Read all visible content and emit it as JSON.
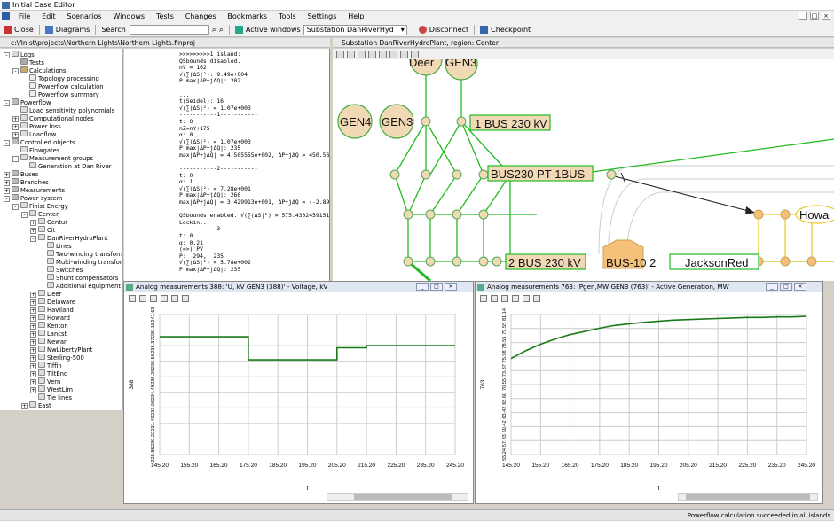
{
  "app": {
    "title": "Initial Case Editor"
  },
  "menu": [
    "File",
    "Edit",
    "Scenarios",
    "Windows",
    "Tests",
    "Changes",
    "Bookmarks",
    "Tools",
    "Settings",
    "Help"
  ],
  "toolbar": {
    "close": "Close",
    "diagrams": "Diagrams",
    "search": "Search",
    "active_windows": "Active windows",
    "substation": "Substation DanRiverHyd",
    "disconnect": "Disconnect",
    "checkpoint": "Checkpoint"
  },
  "project": {
    "path": "c:\\finist\\projects\\Northern Lights\\Northern Lights.finproj"
  },
  "tree": [
    {
      "l": "Logs",
      "d": 0,
      "pm": "-",
      "c": "#d8d8d8"
    },
    {
      "l": "Tests",
      "d": 1,
      "pm": "",
      "c": "#aaa"
    },
    {
      "l": "Calculations",
      "d": 1,
      "pm": "-",
      "c": "#c9a86a"
    },
    {
      "l": "Topology processing",
      "d": 2,
      "pm": "",
      "c": "#eee"
    },
    {
      "l": "Powerflow calculation",
      "d": 2,
      "pm": "",
      "c": "#eee"
    },
    {
      "l": "Powerflow summary",
      "d": 2,
      "pm": "",
      "c": "#eee"
    },
    {
      "l": "Powerflow",
      "d": 0,
      "pm": "-",
      "c": "#bbb"
    },
    {
      "l": "Load sensitivity polynomials",
      "d": 1,
      "pm": "",
      "c": "#ddd"
    },
    {
      "l": "Computational nodes",
      "d": 1,
      "pm": "+",
      "c": "#ddd"
    },
    {
      "l": "Power loss",
      "d": 1,
      "pm": "+",
      "c": "#ddd"
    },
    {
      "l": "Loadflow",
      "d": 1,
      "pm": "+",
      "c": "#ddd"
    },
    {
      "l": "Controlled objects",
      "d": 0,
      "pm": "-",
      "c": "#bbb"
    },
    {
      "l": "Flowgates",
      "d": 1,
      "pm": "",
      "c": "#ddd"
    },
    {
      "l": "Measurement groups",
      "d": 1,
      "pm": "-",
      "c": "#ddd"
    },
    {
      "l": "Generation at Dan River",
      "d": 2,
      "pm": "",
      "c": "#ddd"
    },
    {
      "l": "Buses",
      "d": 0,
      "pm": "+",
      "c": "#bbb"
    },
    {
      "l": "Branches",
      "d": 0,
      "pm": "+",
      "c": "#bbb"
    },
    {
      "l": "Measurements",
      "d": 0,
      "pm": "+",
      "c": "#bbb"
    },
    {
      "l": "Power system",
      "d": 0,
      "pm": "-",
      "c": "#bbb"
    },
    {
      "l": "Finist Energy",
      "d": 1,
      "pm": "-",
      "c": "#ddd"
    },
    {
      "l": "Center",
      "d": 2,
      "pm": "-",
      "c": "#ddd"
    },
    {
      "l": "Centur",
      "d": 3,
      "pm": "+",
      "c": "#ddd"
    },
    {
      "l": "Cit",
      "d": 3,
      "pm": "+",
      "c": "#ddd"
    },
    {
      "l": "DanRiverHydroPlant",
      "d": 3,
      "pm": "-",
      "c": "#ddd"
    },
    {
      "l": "Lines",
      "d": 4,
      "pm": "",
      "c": "#ddd"
    },
    {
      "l": "Two-winding transformers",
      "d": 4,
      "pm": "",
      "c": "#ddd"
    },
    {
      "l": "Multi-winding transformers",
      "d": 4,
      "pm": "",
      "c": "#ddd"
    },
    {
      "l": "Switches",
      "d": 4,
      "pm": "",
      "c": "#ddd"
    },
    {
      "l": "Shunt compensators",
      "d": 4,
      "pm": "",
      "c": "#ddd"
    },
    {
      "l": "Additional equipment",
      "d": 4,
      "pm": "",
      "c": "#ddd"
    },
    {
      "l": "Deer",
      "d": 3,
      "pm": "+",
      "c": "#ddd"
    },
    {
      "l": "Delaware",
      "d": 3,
      "pm": "+",
      "c": "#ddd"
    },
    {
      "l": "Haviland",
      "d": 3,
      "pm": "+",
      "c": "#ddd"
    },
    {
      "l": "Howard",
      "d": 3,
      "pm": "+",
      "c": "#ddd"
    },
    {
      "l": "Kenton",
      "d": 3,
      "pm": "+",
      "c": "#ddd"
    },
    {
      "l": "Lancst",
      "d": 3,
      "pm": "+",
      "c": "#ddd"
    },
    {
      "l": "Newar",
      "d": 3,
      "pm": "+",
      "c": "#ddd"
    },
    {
      "l": "NwLibertyPlant",
      "d": 3,
      "pm": "+",
      "c": "#ddd"
    },
    {
      "l": "Sterling-500",
      "d": 3,
      "pm": "+",
      "c": "#ddd"
    },
    {
      "l": "Tiffin",
      "d": 3,
      "pm": "+",
      "c": "#ddd"
    },
    {
      "l": "TiltEnd",
      "d": 3,
      "pm": "+",
      "c": "#ddd"
    },
    {
      "l": "Vern",
      "d": 3,
      "pm": "+",
      "c": "#ddd"
    },
    {
      "l": "WestLim",
      "d": 3,
      "pm": "+",
      "c": "#ddd"
    },
    {
      "l": "Tie lines",
      "d": 3,
      "pm": "",
      "c": "#ddd"
    },
    {
      "l": "East",
      "d": 2,
      "pm": "+",
      "c": "#ddd"
    }
  ],
  "log": [
    ">>>>>>>>>1 island:",
    "QSbounds disabled.",
    "nV = 162",
    "√(∑(ΔS|²): 9.49e+004",
    "P max|ΔP+jΔQ|: 202",
    "",
    "...",
    "t(Seidel): 16",
    "√(∑(ΔS|²) = 1.07e+003",
    "-----------1-----------",
    "t: 0",
    "nZ=nY+175",
    "α: 0",
    "√(∑(ΔS|²) = 1.07e+003",
    "P max|ΔP+jΔQ|: 235",
    "max|ΔP+jΔQ| = 4.505555e+002, ΔP+jΔQ = 450.56",
    "",
    "-----------2-----------",
    "t: 0",
    "α: 1",
    "√(∑(ΔS|²) = 7.28e+001",
    "P max|ΔP+jΔQ|: 260",
    "max|ΔP+jΔQ| = 3.429913e+001, ΔP+jΔQ = (-2.89-j3",
    "",
    "QSbounds enabled. √(∑(ΔS|²) = 575.430245915133",
    "Lockin...",
    "-----------3-----------",
    "t: 0",
    "α: 0.21",
    "(=>) PV",
    "P:  294,  235",
    "√(∑(ΔS|²) = 5.78e+002",
    "P max|ΔP+jΔQ|: 235"
  ],
  "substation": {
    "header": "Substation DanRiverHydroPlant, region: Center"
  },
  "diagram": {
    "labels": [
      "Deer",
      "GEN3",
      "GEN4",
      "GEN3",
      "1 BUS 230 kV",
      "BUS230 PT-1BUS",
      "2 BUS 230 kV",
      "BUS-10 2",
      "JacksonRed",
      "Howa"
    ]
  },
  "colors": {
    "green": "#22bb22",
    "bus": "#f2d9b5",
    "orange": "#f5c07a",
    "yellow": "#f0e030",
    "trace": "#1a7a1a"
  },
  "charts": [
    {
      "title": "Analog measurements 388: 'U, kV GEN3 (388)' - Voltage, kV",
      "ylabel": "388",
      "xlabel": "t"
    },
    {
      "title": "Analog measurements 763: 'Pgen,MW GEN3 (763)' - Active Generation, MW",
      "ylabel": "763",
      "xlabel": "t"
    }
  ],
  "chart_data": [
    {
      "type": "line",
      "xticks": [
        "145.20",
        "155.20",
        "165.20",
        "175.20",
        "185.20",
        "195.20",
        "205.20",
        "215.20",
        "225.20",
        "235.20",
        "245.20"
      ],
      "yticks": [
        "241.63",
        "239.18",
        "238.37",
        "236.56",
        "235.29",
        "234.48",
        "233.06",
        "231.49",
        "230.22",
        "228.85"
      ],
      "xlim": [
        145.2,
        245.2
      ],
      "ylim": [
        228.85,
        241.63
      ],
      "x": [
        145.2,
        175.2,
        175.2,
        205.2,
        205.2,
        215.2,
        215.2,
        245.2
      ],
      "y": [
        239.6,
        239.6,
        237.5,
        237.5,
        238.6,
        238.6,
        238.8,
        238.8
      ],
      "series_color": "#1a7a1a"
    },
    {
      "type": "line",
      "xticks": [
        "145.20",
        "155.20",
        "165.20",
        "175.20",
        "185.20",
        "195.20",
        "205.20",
        "215.20",
        "225.20",
        "235.20",
        "245.20"
      ],
      "yticks": [
        "81.14",
        "79.55",
        "78.55",
        "75.98",
        "73.37",
        "70.55",
        "65.60",
        "63.42",
        "60.42",
        "57.83",
        "55.24"
      ],
      "xlim": [
        145.2,
        245.2
      ],
      "ylim": [
        55.24,
        81.14
      ],
      "x": [
        145.2,
        150,
        155,
        160,
        165,
        170,
        175,
        180,
        185,
        190,
        195,
        200,
        205,
        210,
        215,
        220,
        225,
        230,
        235,
        240,
        245.2
      ],
      "y": [
        73.0,
        74.4,
        75.6,
        76.6,
        77.4,
        78.0,
        78.6,
        79.1,
        79.4,
        79.7,
        79.9,
        80.1,
        80.2,
        80.3,
        80.4,
        80.5,
        80.6,
        80.6,
        80.7,
        80.7,
        80.8
      ],
      "series_color": "#1a7a1a"
    }
  ],
  "status": "Powerflow calculation succeeded in all islands"
}
